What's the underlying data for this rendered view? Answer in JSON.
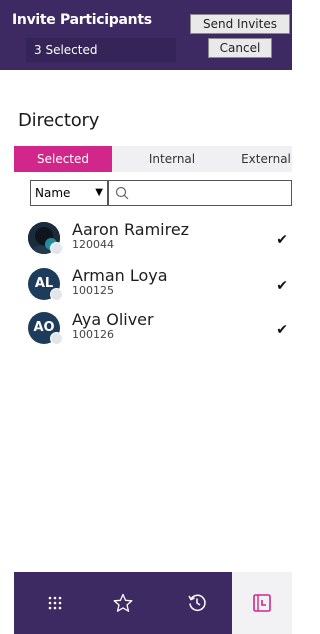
{
  "header": {
    "title": "Invite Participants",
    "selected_count": "3 Selected",
    "send_label": "Send Invites",
    "cancel_label": "Cancel"
  },
  "directory": {
    "title": "Directory",
    "tabs": [
      {
        "label": "Selected",
        "active": true
      },
      {
        "label": "Internal",
        "active": false
      },
      {
        "label": "External",
        "active": false
      }
    ],
    "filter_value": "Name",
    "search_placeholder": ""
  },
  "people": [
    {
      "name": "Aaron Ramirez",
      "id": "120044",
      "initials": "",
      "avatar": "photo",
      "selected": true
    },
    {
      "name": "Arman Loya",
      "id": "100125",
      "initials": "AL",
      "avatar": "initials",
      "selected": true
    },
    {
      "name": "Aya Oliver",
      "id": "100126",
      "initials": "AO",
      "avatar": "initials",
      "selected": true
    }
  ],
  "bottom_nav": [
    {
      "icon": "grid-icon",
      "active": false
    },
    {
      "icon": "star-icon",
      "active": false
    },
    {
      "icon": "history-icon",
      "active": false
    },
    {
      "icon": "calendar-clock-icon",
      "active": true
    }
  ],
  "colors": {
    "header_bg": "#3e2a63",
    "accent": "#d1268a"
  }
}
